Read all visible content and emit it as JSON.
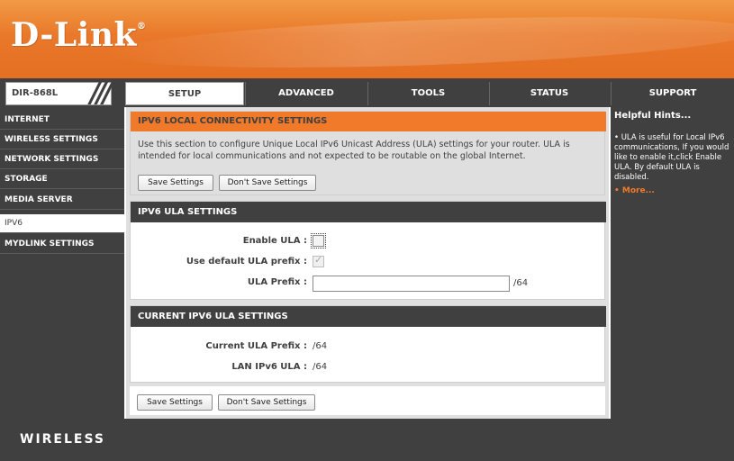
{
  "brand": {
    "logo": "D-Link",
    "tm": "®",
    "footer_logo": "WIRELESS"
  },
  "model": {
    "label": "DIR-868L",
    "slashes": "///"
  },
  "nav": {
    "tabs": [
      {
        "label": "SETUP"
      },
      {
        "label": "ADVANCED"
      },
      {
        "label": "TOOLS"
      },
      {
        "label": "STATUS"
      },
      {
        "label": "SUPPORT"
      }
    ],
    "active": "SETUP"
  },
  "sidebar": {
    "items": [
      {
        "label": "INTERNET"
      },
      {
        "label": "WIRELESS SETTINGS"
      },
      {
        "label": "NETWORK SETTINGS"
      },
      {
        "label": "STORAGE"
      },
      {
        "label": "MEDIA SERVER"
      },
      {
        "label": "IPV6"
      },
      {
        "label": "MYDLINK SETTINGS"
      }
    ],
    "active": "IPV6"
  },
  "local_connectivity": {
    "title": "IPV6 LOCAL CONNECTIVITY SETTINGS",
    "description": "Use this section to configure Unique Local IPv6 Unicast Address (ULA) settings for your router. ULA is intended for local communications and not expected to be routable on the global Internet.",
    "save_label": "Save Settings",
    "dont_save_label": "Don't Save Settings"
  },
  "ula_settings": {
    "title": "IPV6 ULA SETTINGS",
    "enable_label": "Enable ULA :",
    "enable_checked": false,
    "default_prefix_label": "Use default ULA prefix :",
    "default_prefix_checked": true,
    "default_prefix_disabled": true,
    "prefix_label": "ULA Prefix :",
    "prefix_value": "",
    "prefix_suffix": "/64"
  },
  "current_settings": {
    "title": "CURRENT IPV6 ULA SETTINGS",
    "current_prefix_label": "Current ULA Prefix :",
    "current_prefix_value": "/64",
    "lan_ula_label": "LAN IPv6 ULA :",
    "lan_ula_value": "/64"
  },
  "bottom": {
    "save_label": "Save Settings",
    "dont_save_label": "Don't Save Settings"
  },
  "hints": {
    "title": "Helpful Hints...",
    "text": "• ULA is useful for Local IPv6 communications, If you would like to enable it,click Enable ULA. By default ULA is disabled.",
    "more": "• More..."
  },
  "colors": {
    "accent_orange": "#f0792a",
    "dark_gray": "#404040",
    "content_bg": "#dfdfdf"
  }
}
